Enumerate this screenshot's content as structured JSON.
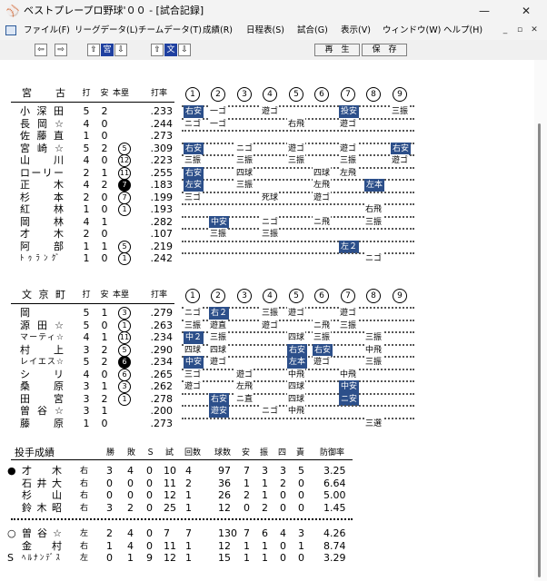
{
  "window": {
    "title": "ベストプレープロ野球'００ - [試合記録]"
  },
  "menu": [
    "ファイル(F)",
    "リーグデータ(L)",
    "チームデータ(T)",
    "成績(R)",
    "日程表(S)",
    "試合(G)",
    "表示(V)",
    "ウィンドウ(W)",
    "ヘルプ(H)"
  ],
  "toolbar": {
    "team1": "宮",
    "team2": "文",
    "play_label": "再　生",
    "save_label": "保　存"
  },
  "home": {
    "team": "宮　古",
    "headers": {
      "ab": "打",
      "h": "安",
      "hr": "本塁",
      "avg": "打率",
      "innings": [
        "1",
        "2",
        "3",
        "4",
        "5",
        "6",
        "7",
        "8",
        "9"
      ]
    },
    "players": [
      {
        "name": "小深田",
        "ab": "5",
        "h": "2",
        "hr": "",
        "avg": ".233",
        "cells": [
          "右安",
          "一ゴ",
          "",
          "遊ゴ",
          "",
          "",
          "投安",
          "",
          "三振"
        ],
        "boxed": [
          1,
          0,
          0,
          0,
          0,
          0,
          1,
          0,
          0
        ]
      },
      {
        "name": "長岡☆",
        "ab": "4",
        "h": "0",
        "hr": "",
        "avg": ".244",
        "cells": [
          "ニゴ",
          "一ゴ",
          "",
          "",
          "右飛",
          "",
          "遊ゴ",
          "",
          ""
        ],
        "boxed": [
          0,
          0,
          0,
          0,
          0,
          0,
          0,
          0,
          0
        ]
      },
      {
        "name": "佐藤直",
        "ab": "1",
        "h": "0",
        "hr": "",
        "avg": ".273",
        "cells": [
          "",
          "",
          "",
          "",
          "",
          "",
          "",
          "",
          ""
        ],
        "boxed": [
          0,
          0,
          0,
          0,
          0,
          0,
          0,
          0,
          0
        ]
      },
      {
        "name": "宮崎☆",
        "ab": "5",
        "h": "2",
        "hr": "5",
        "avg": ".309",
        "cells": [
          "右安",
          "",
          "ニゴ",
          "",
          "遊ゴ",
          "",
          "遊ゴ",
          "",
          "右安"
        ],
        "boxed": [
          1,
          0,
          0,
          0,
          0,
          0,
          0,
          0,
          1
        ]
      },
      {
        "name": "山川",
        "ab": "4",
        "h": "0",
        "hr": "12",
        "avg": ".223",
        "cells": [
          "三振",
          "",
          "三振",
          "",
          "三振",
          "",
          "三振",
          "",
          "遊ゴ"
        ],
        "boxed": [
          0,
          0,
          0,
          0,
          0,
          0,
          0,
          0,
          0
        ]
      },
      {
        "name": "ローリー",
        "ab": "2",
        "h": "1",
        "hr": "11",
        "avg": ".255",
        "cells": [
          "右安",
          "",
          "四球",
          "",
          "",
          "四球",
          "左飛",
          "",
          ""
        ],
        "boxed": [
          1,
          0,
          0,
          0,
          0,
          0,
          0,
          0,
          0
        ]
      },
      {
        "name": "正木",
        "ab": "4",
        "h": "2",
        "hr": "7",
        "avg": ".183",
        "cells": [
          "左安",
          "",
          "三振",
          "",
          "",
          "左飛",
          "",
          "左本",
          ""
        ],
        "boxed": [
          1,
          0,
          0,
          0,
          0,
          0,
          0,
          1,
          0
        ],
        "hr_fill": true
      },
      {
        "name": "杉本",
        "ab": "2",
        "h": "0",
        "hr": "7",
        "avg": ".199",
        "cells": [
          "三ゴ",
          "",
          "",
          "死球",
          "",
          "遊ゴ",
          "",
          "",
          ""
        ],
        "boxed": [
          0,
          0,
          0,
          0,
          0,
          0,
          0,
          0,
          0
        ]
      },
      {
        "name": "紅林",
        "ab": "1",
        "h": "0",
        "hr": "1",
        "avg": ".193",
        "cells": [
          "",
          "",
          "",
          "",
          "",
          "",
          "",
          "右飛",
          ""
        ],
        "boxed": [
          0,
          0,
          0,
          0,
          0,
          0,
          0,
          0,
          0
        ]
      },
      {
        "name": "岡林",
        "ab": "4",
        "h": "1",
        "hr": "",
        "avg": ".282",
        "cells": [
          "",
          "中安",
          "",
          "ニゴ",
          "",
          "ニ飛",
          "",
          "三振",
          ""
        ],
        "boxed": [
          0,
          1,
          0,
          0,
          0,
          0,
          0,
          0,
          0
        ]
      },
      {
        "name": "才木",
        "ab": "2",
        "h": "0",
        "hr": "",
        "avg": ".107",
        "cells": [
          "",
          "三振",
          "",
          "三振",
          "",
          "",
          "",
          "",
          ""
        ],
        "boxed": [
          0,
          0,
          0,
          0,
          0,
          0,
          0,
          0,
          0
        ]
      },
      {
        "name": "阿部",
        "ab": "1",
        "h": "1",
        "hr": "5",
        "avg": ".219",
        "cells": [
          "",
          "",
          "",
          "",
          "",
          "",
          "左２",
          "",
          ""
        ],
        "boxed": [
          0,
          0,
          0,
          0,
          0,
          0,
          1,
          0,
          0
        ]
      },
      {
        "name": "ﾄｩﾗﾝｸﾞ",
        "ab": "1",
        "h": "0",
        "hr": "1",
        "avg": ".242",
        "cells": [
          "",
          "",
          "",
          "",
          "",
          "",
          "",
          "ニゴ",
          ""
        ],
        "boxed": [
          0,
          0,
          0,
          0,
          0,
          0,
          0,
          0,
          0
        ]
      }
    ]
  },
  "away": {
    "team": "文京町",
    "headers": {
      "ab": "打",
      "h": "安",
      "hr": "本塁",
      "avg": "打率",
      "innings": [
        "1",
        "2",
        "3",
        "4",
        "5",
        "6",
        "7",
        "8",
        "9"
      ]
    },
    "players": [
      {
        "name": "岡",
        "ab": "5",
        "h": "1",
        "hr": "3",
        "avg": ".279",
        "cells": [
          "ニゴ",
          "右２",
          "",
          "三振",
          "遊ゴ",
          "",
          "遊ゴ",
          "",
          ""
        ],
        "boxed": [
          0,
          1,
          0,
          0,
          0,
          0,
          0,
          0,
          0
        ]
      },
      {
        "name": "源田☆",
        "ab": "5",
        "h": "0",
        "hr": "1",
        "avg": ".263",
        "cells": [
          "三振",
          "遊直",
          "",
          "遊ゴ",
          "",
          "ニ飛",
          "三振",
          "",
          ""
        ],
        "boxed": [
          0,
          0,
          0,
          0,
          0,
          0,
          0,
          0,
          0
        ]
      },
      {
        "name": "マーティ☆",
        "ab": "4",
        "h": "1",
        "hr": "11",
        "avg": ".234",
        "cells": [
          "中２",
          "三振",
          "",
          "",
          "四球",
          "三振",
          "",
          "三振",
          ""
        ],
        "boxed": [
          1,
          0,
          0,
          0,
          0,
          0,
          0,
          0,
          0
        ]
      },
      {
        "name": "村上",
        "ab": "3",
        "h": "2",
        "hr": "5",
        "avg": ".290",
        "cells": [
          "四球",
          "四球",
          "",
          "",
          "右安",
          "右安",
          "",
          "中飛",
          ""
        ],
        "boxed": [
          0,
          0,
          0,
          0,
          1,
          1,
          0,
          0,
          0
        ]
      },
      {
        "name": "レイエス☆",
        "ab": "5",
        "h": "2",
        "hr": "6",
        "avg": ".234",
        "cells": [
          "中安",
          "遊ゴ",
          "",
          "",
          "左本",
          "遊ゴ",
          "",
          "三振",
          ""
        ],
        "boxed": [
          1,
          0,
          0,
          0,
          1,
          0,
          0,
          0,
          0
        ],
        "hr_fill": true
      },
      {
        "name": "シリ",
        "ab": "4",
        "h": "0",
        "hr": "6",
        "avg": ".265",
        "cells": [
          "三ゴ",
          "",
          "遊ゴ",
          "",
          "中飛",
          "",
          "中飛",
          "",
          ""
        ],
        "boxed": [
          0,
          0,
          0,
          0,
          0,
          0,
          0,
          0,
          0
        ]
      },
      {
        "name": "桑原",
        "ab": "3",
        "h": "1",
        "hr": "3",
        "avg": ".262",
        "cells": [
          "遊ゴ",
          "",
          "左飛",
          "",
          "四球",
          "",
          "中安",
          "",
          ""
        ],
        "boxed": [
          0,
          0,
          0,
          0,
          0,
          0,
          1,
          0,
          0
        ]
      },
      {
        "name": "田宮",
        "ab": "3",
        "h": "2",
        "hr": "1",
        "avg": ".278",
        "cells": [
          "",
          "右安",
          "ニ直",
          "",
          "四球",
          "",
          "ニ安",
          "",
          ""
        ],
        "boxed": [
          0,
          1,
          0,
          0,
          0,
          0,
          1,
          0,
          0
        ]
      },
      {
        "name": "曽谷☆",
        "ab": "3",
        "h": "1",
        "hr": "",
        "avg": ".200",
        "cells": [
          "",
          "遊安",
          "",
          "ニゴ",
          "中飛",
          "",
          "",
          "",
          ""
        ],
        "boxed": [
          0,
          1,
          0,
          0,
          0,
          0,
          0,
          0,
          0
        ]
      },
      {
        "name": "藤原",
        "ab": "1",
        "h": "0",
        "hr": "",
        "avg": ".273",
        "cells": [
          "",
          "",
          "",
          "",
          "",
          "",
          "",
          "三選",
          ""
        ],
        "boxed": [
          0,
          0,
          0,
          0,
          0,
          0,
          0,
          0,
          0
        ]
      }
    ]
  },
  "pitching": {
    "title": "投手成績",
    "headers": [
      "勝",
      "敗",
      "Ｓ",
      "試",
      "回数",
      "球数",
      "安",
      "振",
      "四",
      "責",
      "防御率"
    ],
    "home": [
      {
        "mark": "●",
        "name": "才木",
        "hand": "右",
        "w": "3",
        "l": "4",
        "s": "0",
        "g": "10",
        "ip": "4",
        "np": "97",
        "h": "7",
        "k": "3",
        "bb": "3",
        "er": "5",
        "era": "3.25"
      },
      {
        "mark": "",
        "name": "石井大",
        "hand": "右",
        "w": "0",
        "l": "0",
        "s": "0",
        "g": "11",
        "ip": "2",
        "np": "36",
        "h": "1",
        "k": "1",
        "bb": "2",
        "er": "0",
        "era": "6.64"
      },
      {
        "mark": "",
        "name": "杉山",
        "hand": "右",
        "w": "0",
        "l": "0",
        "s": "0",
        "g": "12",
        "ip": "1",
        "np": "26",
        "h": "2",
        "k": "1",
        "bb": "0",
        "er": "0",
        "era": "5.00"
      },
      {
        "mark": "",
        "name": "鈴木昭",
        "hand": "右",
        "w": "3",
        "l": "2",
        "s": "0",
        "g": "25",
        "ip": "1",
        "np": "12",
        "h": "0",
        "k": "2",
        "bb": "0",
        "er": "0",
        "era": "1.45"
      }
    ],
    "away": [
      {
        "mark": "○",
        "name": "曽谷☆",
        "hand": "左",
        "w": "2",
        "l": "4",
        "s": "0",
        "g": "7",
        "ip": "7",
        "np": "130",
        "h": "7",
        "k": "6",
        "bb": "4",
        "er": "3",
        "era": "4.26"
      },
      {
        "mark": "",
        "name": "金村",
        "hand": "右",
        "w": "1",
        "l": "4",
        "s": "0",
        "g": "11",
        "ip": "1",
        "np": "12",
        "h": "1",
        "k": "1",
        "bb": "0",
        "er": "1",
        "era": "8.74"
      },
      {
        "mark": "S",
        "name": "ﾍﾙﾅﾝﾃﾞｽ",
        "hand": "左",
        "w": "0",
        "l": "1",
        "s": "9",
        "g": "12",
        "ip": "1",
        "np": "15",
        "h": "1",
        "k": "1",
        "bb": "0",
        "er": "0",
        "era": "3.29"
      }
    ]
  }
}
